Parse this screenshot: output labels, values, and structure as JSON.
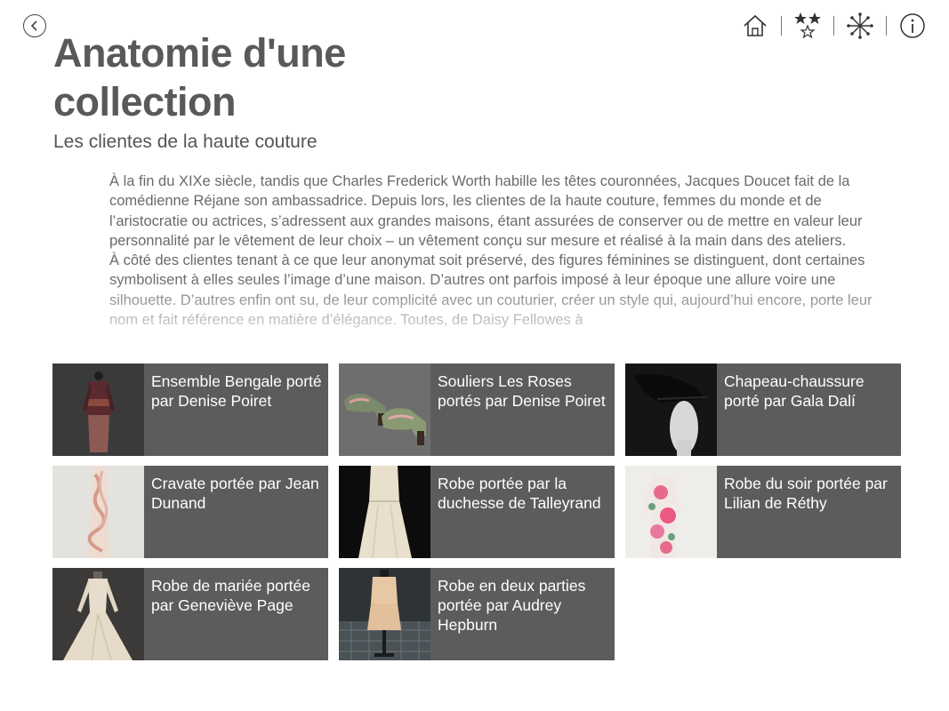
{
  "header": {
    "title": "Anatomie d'une collection",
    "subtitle": "Les clientes de la haute couture"
  },
  "icons": {
    "back": "back-arrow-icon",
    "home": "home-icon",
    "favorites": "stars-icon",
    "explore": "asterisk-icon",
    "info": "info-icon"
  },
  "body": {
    "paragraphs": [
      "À la fin du XIXe siècle, tandis que Charles Frederick Worth habille les têtes couronnées, Jacques Doucet fait de la comédienne Réjane son ambassadrice. Depuis lors, les clientes de la haute couture, femmes du monde et de l’aristocratie ou actrices, s’adressent aux grandes maisons, étant assurées de conserver ou de mettre en valeur leur personnalité par le vêtement de leur choix – un vêtement conçu sur mesure et réalisé à la main dans des ateliers.",
      "À côté des clientes tenant à ce que leur anonymat soit préservé, des figures féminines se distinguent, dont certaines symbolisent à elles seules l’image d’une maison. D’autres ont parfois imposé à leur époque une allure voire une silhouette. D’autres enfin ont su, de leur complicité avec un couturier, créer un style qui, aujourd’hui encore, porte leur nom et fait référence en matière d’élégance. Toutes, de Daisy Fellowes à"
    ]
  },
  "cards": [
    {
      "label": "Ensemble Bengale porté par Denise Poiret"
    },
    {
      "label": "Souliers Les Roses portés par Denise Poiret"
    },
    {
      "label": "Chapeau-chaussure porté par Gala Dalí"
    },
    {
      "label": "Cravate portée par Jean Dunand"
    },
    {
      "label": "Robe portée par la duchesse de Talleyrand"
    },
    {
      "label": "Robe du soir portée par Lilian de Réthy"
    },
    {
      "label": "Robe de mariée portée par Geneviève Page"
    },
    {
      "label": "Robe en deux parties portée par Audrey Hepburn"
    }
  ],
  "colors": {
    "card_background": "#5c5c5c",
    "title": "#595959",
    "body_text": "#6a6a6a"
  }
}
